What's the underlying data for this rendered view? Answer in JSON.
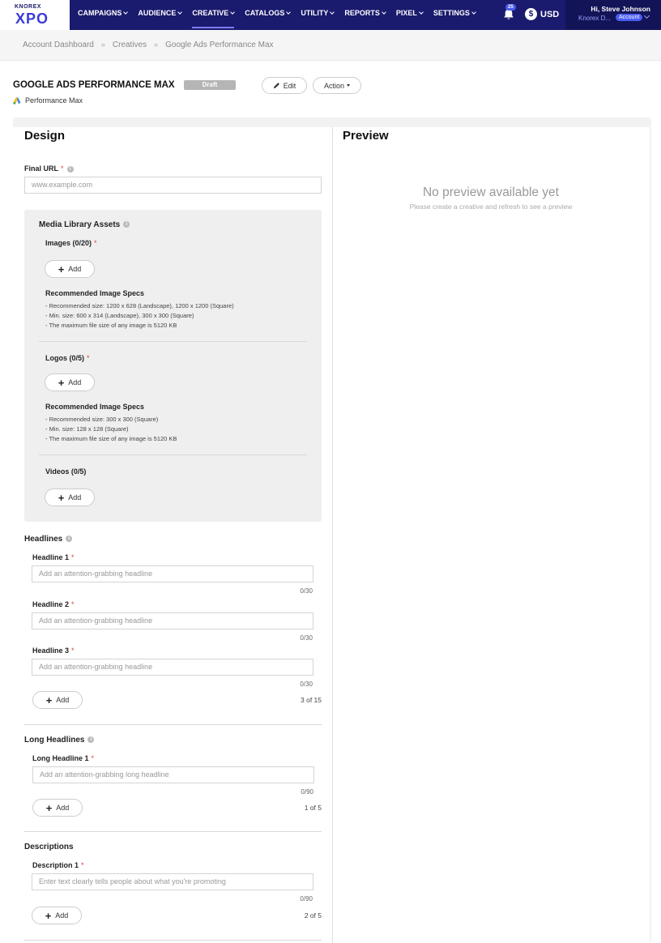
{
  "nav": {
    "logo_small": "KNOREX",
    "logo_big": "XPO",
    "items": [
      "CAMPAIGNS",
      "AUDIENCE",
      "CREATIVE",
      "CATALOGS",
      "UTILITY",
      "REPORTS",
      "PIXEL",
      "SETTINGS"
    ],
    "notification_count": "25",
    "currency": "USD",
    "greeting": "Hi, Steve Johnson",
    "org": "Knorex D...",
    "account_badge": "Account"
  },
  "breadcrumb": [
    "Account Dashboard",
    "Creatives",
    "Google Ads Performance Max"
  ],
  "page": {
    "title": "GOOGLE ADS PERFORMANCE MAX",
    "status": "Draft",
    "edit_label": "Edit",
    "action_label": "Action",
    "subtype": "Performance Max"
  },
  "design": {
    "heading": "Design",
    "final_url": {
      "label": "Final URL",
      "placeholder": "www.example.com"
    },
    "media": {
      "title": "Media Library Assets",
      "images": {
        "label": "Images (0/20)",
        "add": "Add",
        "spec_title": "Recommended Image Specs",
        "specs": [
          "- Recommended size: 1200 x 628 (Landscape), 1200 x 1200 (Square)",
          "- Min. size: 600 x 314 (Landscape), 300 x 300 (Square)",
          "- The maximum file size of any image is 5120 KB"
        ]
      },
      "logos": {
        "label": "Logos (0/5)",
        "add": "Add",
        "spec_title": "Recommended Image Specs",
        "specs": [
          "- Recommended size: 300 x 300 (Square)",
          "- Min. size: 128 x 128 (Square)",
          "- The maximum file size of any image is 5120 KB"
        ]
      },
      "videos": {
        "label": "Videos (0/5)",
        "add": "Add"
      }
    },
    "headlines": {
      "title": "Headlines",
      "fields": [
        {
          "label": "Headline 1",
          "placeholder": "Add an attention-grabbing headline",
          "counter": "0/30"
        },
        {
          "label": "Headline 2",
          "placeholder": "Add an attention-grabbing headline",
          "counter": "0/30"
        },
        {
          "label": "Headline 3",
          "placeholder": "Add an attention-grabbing headline",
          "counter": "0/30"
        }
      ],
      "add": "Add",
      "count": "3 of 15"
    },
    "long_headlines": {
      "title": "Long Headlines",
      "fields": [
        {
          "label": "Long Headline 1",
          "placeholder": "Add an attention-grabbing long headline",
          "counter": "0/90"
        }
      ],
      "add": "Add",
      "count": "1 of 5"
    },
    "descriptions": {
      "title": "Descriptions",
      "fields": [
        {
          "label": "Description 1",
          "placeholder": "Enter text clearly tells people about what you're promoting",
          "counter": "0/90"
        }
      ],
      "add": "Add",
      "count": "2 of 5"
    }
  },
  "preview": {
    "heading": "Preview",
    "empty_title": "No preview available yet",
    "empty_sub": "Please create a creative and refresh to see a preview"
  },
  "colors": {
    "nav_bg": "#1a1a6e",
    "accent": "#4a5cf0",
    "required": "#e04040"
  }
}
